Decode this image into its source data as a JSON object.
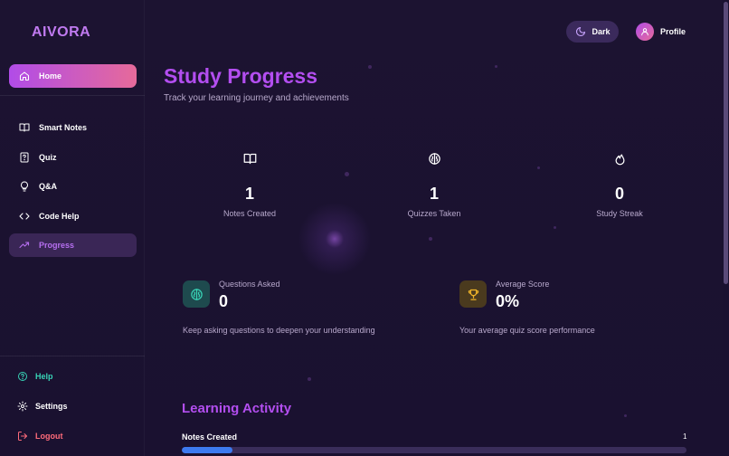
{
  "brand": {
    "name": "AIVORA"
  },
  "header": {
    "theme_toggle_label": "Dark",
    "profile_label": "Profile"
  },
  "sidebar": {
    "items": [
      {
        "label": "Home",
        "icon": "home-icon"
      },
      {
        "label": "Smart Notes",
        "icon": "book-icon"
      },
      {
        "label": "Quiz",
        "icon": "quiz-icon"
      },
      {
        "label": "Q&A",
        "icon": "lightbulb-icon"
      },
      {
        "label": "Code Help",
        "icon": "code-icon"
      },
      {
        "label": "Progress",
        "icon": "trending-up-icon"
      }
    ],
    "bottom": [
      {
        "label": "Help",
        "icon": "help-icon",
        "color": "#38d3b6"
      },
      {
        "label": "Settings",
        "icon": "gear-icon",
        "color": "#ffffff"
      },
      {
        "label": "Logout",
        "icon": "logout-icon",
        "color": "#ff6b7a"
      }
    ]
  },
  "main": {
    "title": "Study Progress",
    "subtitle": "Track your learning journey and achievements",
    "stats": [
      {
        "icon": "book-icon",
        "value": "1",
        "label": "Notes Created"
      },
      {
        "icon": "brain-icon",
        "value": "1",
        "label": "Quizzes Taken"
      },
      {
        "icon": "flame-icon",
        "value": "0",
        "label": "Study Streak"
      }
    ],
    "cards": [
      {
        "icon": "brain-icon",
        "label": "Questions Asked",
        "value": "0",
        "description": "Keep asking questions to deepen your understanding",
        "accent": "#38d3b6"
      },
      {
        "icon": "trophy-icon",
        "label": "Average Score",
        "value": "0%",
        "description": "Your average quiz score performance",
        "accent": "#f0b429"
      }
    ],
    "activity": {
      "title": "Learning Activity",
      "rows": [
        {
          "label": "Notes Created",
          "count": "1",
          "progress": 0.1
        }
      ]
    }
  },
  "colors": {
    "accent": "#b34ef0",
    "active_gradient_start": "#b14ce8",
    "active_gradient_end": "#e66a9a",
    "progress_fill": "#3d7af0"
  }
}
